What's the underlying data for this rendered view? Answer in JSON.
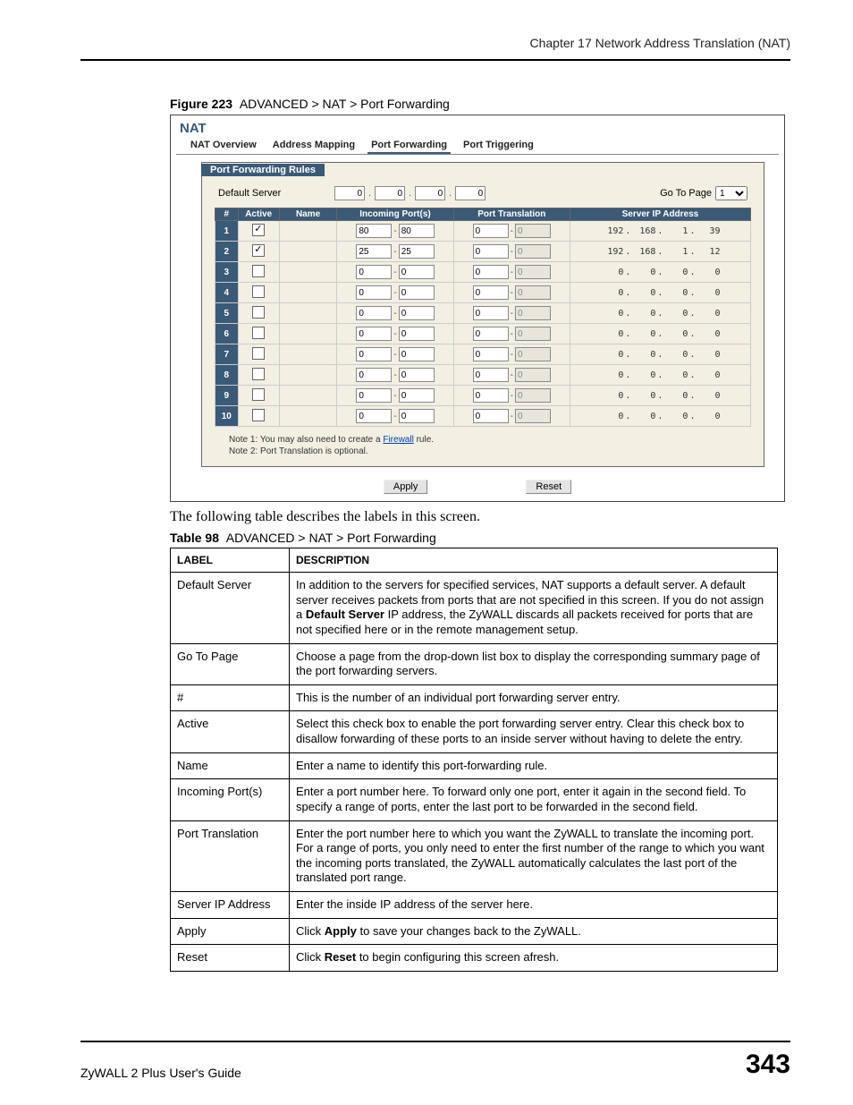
{
  "header": {
    "chapter": "Chapter 17 Network Address Translation (NAT)"
  },
  "figure": {
    "prefix": "Figure 223",
    "title": "ADVANCED > NAT > Port Forwarding"
  },
  "nat": {
    "panel_title": "NAT",
    "tabs": {
      "overview": "NAT Overview",
      "mapping": "Address Mapping",
      "forwarding": "Port Forwarding",
      "triggering": "Port Triggering"
    },
    "rules_header": "Port Forwarding Rules",
    "default_server_label": "Default Server",
    "default_server_ip": [
      "0",
      "0",
      "0",
      "0"
    ],
    "go_label": "Go To Page",
    "go_value": "1",
    "columns": {
      "num": "#",
      "active": "Active",
      "name": "Name",
      "incoming": "Incoming Port(s)",
      "translation": "Port Translation",
      "server": "Server IP Address"
    },
    "rows": [
      {
        "n": "1",
        "active": true,
        "name": "",
        "p1": "80",
        "p2": "80",
        "t1": "0",
        "t2": "0",
        "ip": [
          "192",
          "168",
          "1",
          "39"
        ]
      },
      {
        "n": "2",
        "active": true,
        "name": "",
        "p1": "25",
        "p2": "25",
        "t1": "0",
        "t2": "0",
        "ip": [
          "192",
          "168",
          "1",
          "12"
        ]
      },
      {
        "n": "3",
        "active": false,
        "name": "",
        "p1": "0",
        "p2": "0",
        "t1": "0",
        "t2": "0",
        "ip": [
          "0",
          "0",
          "0",
          "0"
        ]
      },
      {
        "n": "4",
        "active": false,
        "name": "",
        "p1": "0",
        "p2": "0",
        "t1": "0",
        "t2": "0",
        "ip": [
          "0",
          "0",
          "0",
          "0"
        ]
      },
      {
        "n": "5",
        "active": false,
        "name": "",
        "p1": "0",
        "p2": "0",
        "t1": "0",
        "t2": "0",
        "ip": [
          "0",
          "0",
          "0",
          "0"
        ]
      },
      {
        "n": "6",
        "active": false,
        "name": "",
        "p1": "0",
        "p2": "0",
        "t1": "0",
        "t2": "0",
        "ip": [
          "0",
          "0",
          "0",
          "0"
        ]
      },
      {
        "n": "7",
        "active": false,
        "name": "",
        "p1": "0",
        "p2": "0",
        "t1": "0",
        "t2": "0",
        "ip": [
          "0",
          "0",
          "0",
          "0"
        ]
      },
      {
        "n": "8",
        "active": false,
        "name": "",
        "p1": "0",
        "p2": "0",
        "t1": "0",
        "t2": "0",
        "ip": [
          "0",
          "0",
          "0",
          "0"
        ]
      },
      {
        "n": "9",
        "active": false,
        "name": "",
        "p1": "0",
        "p2": "0",
        "t1": "0",
        "t2": "0",
        "ip": [
          "0",
          "0",
          "0",
          "0"
        ]
      },
      {
        "n": "10",
        "active": false,
        "name": "",
        "p1": "0",
        "p2": "0",
        "t1": "0",
        "t2": "0",
        "ip": [
          "0",
          "0",
          "0",
          "0"
        ]
      }
    ],
    "note1_pre": "Note 1: You may also need to create a ",
    "note1_link": "Firewall",
    "note1_post": " rule.",
    "note2": "Note 2: Port Translation is optional.",
    "apply": "Apply",
    "reset": "Reset"
  },
  "intro": "The following table describes the labels in this screen.",
  "table98": {
    "prefix": "Table 98",
    "title": "ADVANCED > NAT > Port Forwarding",
    "h_label": "LABEL",
    "h_desc": "DESCRIPTION",
    "rows": [
      {
        "label": "Default Server",
        "desc_pre": "In addition to the servers for specified services, NAT supports a default server. A default server receives packets from ports that are not specified in this screen. If you do not assign a ",
        "desc_b": "Default Server",
        "desc_post": " IP address, the ZyWALL discards all packets received for ports that are not specified here or in the remote management setup."
      },
      {
        "label": "Go To Page",
        "desc": "Choose a page from the drop-down list box to display the corresponding summary page of the port forwarding servers."
      },
      {
        "label": "#",
        "desc": "This is the number of an individual port forwarding server entry."
      },
      {
        "label": "Active",
        "desc": "Select this check box to enable the port forwarding server entry. Clear this check box to disallow forwarding of these ports to an inside server without having to delete the entry."
      },
      {
        "label": "Name",
        "desc": "Enter a name to identify this port-forwarding rule."
      },
      {
        "label": "Incoming Port(s)",
        "desc": "Enter a port number here. To forward only one port, enter it again in the second field. To specify a range of ports, enter the last port to be forwarded in the second field."
      },
      {
        "label": "Port Translation",
        "desc": "Enter the port number here to which you want the ZyWALL to translate the incoming port. For a range of ports, you only need to enter the first number of the range to which you want the incoming ports translated, the ZyWALL automatically calculates the last port of the translated port range."
      },
      {
        "label": "Server IP Address",
        "desc": "Enter the inside IP address of the server here."
      },
      {
        "label": "Apply",
        "desc_pre": "Click ",
        "desc_b": "Apply",
        "desc_post": " to save your changes back to the ZyWALL."
      },
      {
        "label": "Reset",
        "desc_pre": "Click ",
        "desc_b": "Reset",
        "desc_post": " to begin configuring this screen afresh."
      }
    ]
  },
  "footer": {
    "guide": "ZyWALL 2 Plus User's Guide",
    "page": "343"
  }
}
